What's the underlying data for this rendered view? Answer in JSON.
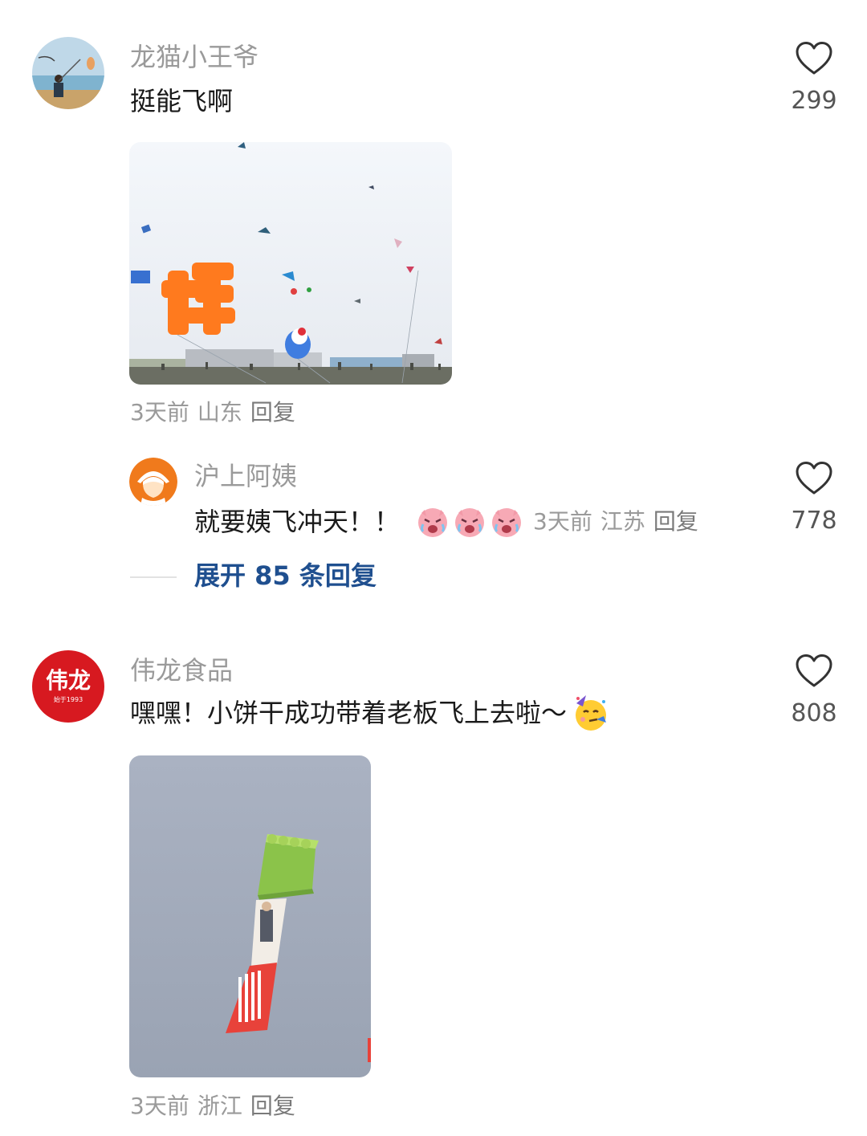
{
  "comments": [
    {
      "username": "龙猫小王爷",
      "text": "挺能飞啊",
      "likes": "299",
      "time": "3天前",
      "location": "山东",
      "reply_label": "回复",
      "image": "kite-festival-photo"
    },
    {
      "username": "伟龙食品",
      "avatar_text": "伟龙",
      "avatar_sub": "始于1993",
      "text": "嘿嘿！小饼干成功带着老板飞上去啦～",
      "likes": "808",
      "time": "3天前",
      "location": "浙江",
      "reply_label": "回复",
      "image": "biscuit-kite-photo"
    }
  ],
  "sub_reply": {
    "username": "沪上阿姨",
    "text": "就要姨飞冲天！！",
    "likes": "778",
    "time": "3天前",
    "location": "江苏",
    "reply_label": "回复"
  },
  "expand_label": "展开 85 条回复",
  "colors": {
    "username": "#9a9a9a",
    "expand_link": "#1f4f8f",
    "weilong_brand": "#d71920",
    "huyi_brand": "#f07a1c"
  }
}
